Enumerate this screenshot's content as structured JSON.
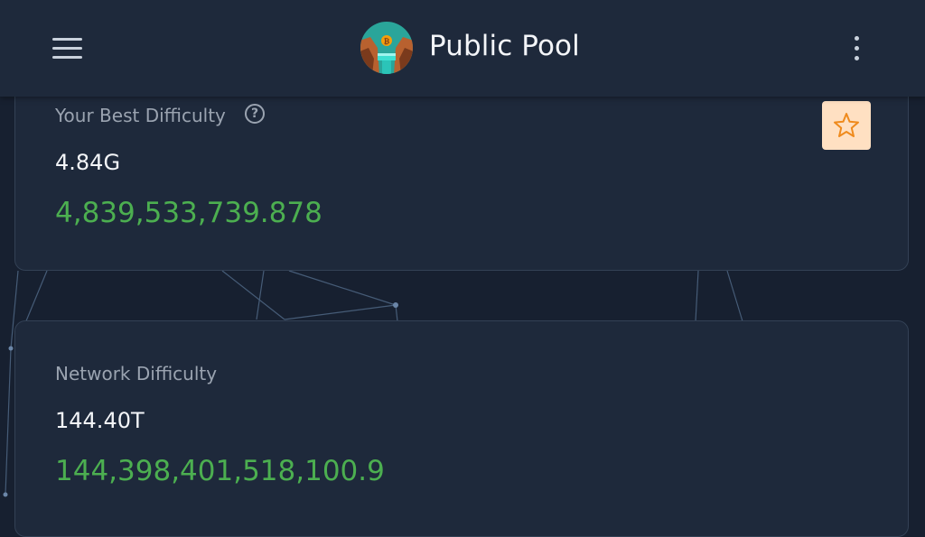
{
  "header": {
    "title": "Public Pool"
  },
  "best": {
    "label": "Your Best Difficulty",
    "abbr": "4.84G",
    "full": "4,839,533,739.878"
  },
  "network": {
    "label": "Network Difficulty",
    "abbr": "144.40T",
    "full": "144,398,401,518,100.9"
  },
  "colors": {
    "accent_green": "#4caf50",
    "card_bg": "#1e293b",
    "star_bg": "#ffe0c2",
    "star_stroke": "#ef8a1c"
  },
  "icons": [
    "menu-icon",
    "logo-icon",
    "more-vertical-icon",
    "help-circle-icon",
    "star-icon"
  ]
}
